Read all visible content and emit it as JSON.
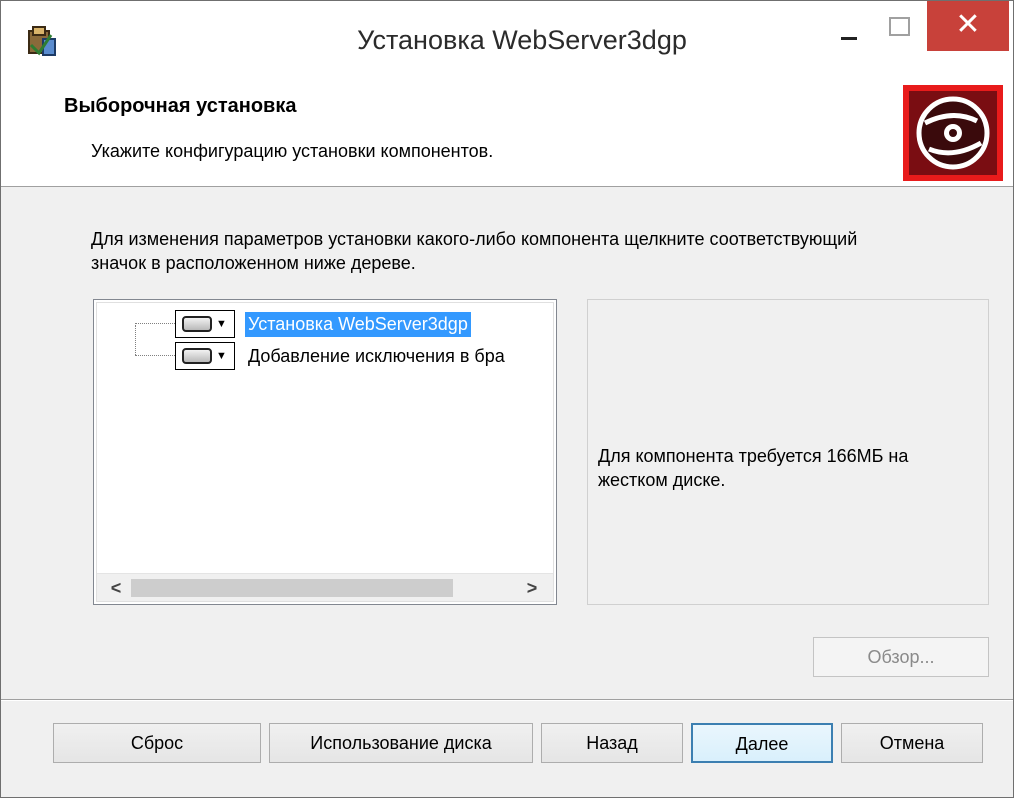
{
  "window": {
    "title": "Установка WebServer3dgp",
    "icons": {
      "app": "installer-icon",
      "minimize": "minimize-icon",
      "maximize": "maximize-icon",
      "close": "close-icon"
    },
    "close_glyph": "✕"
  },
  "header": {
    "title": "Выборочная установка",
    "subtitle": "Укажите конфигурацию установки компонентов.",
    "icon": "disc-icon",
    "accent_color": "#e81b1b"
  },
  "instructions": "Для изменения параметров установки какого-либо компонента щелкните соответствующий значок в расположенном ниже дереве.",
  "feature_tree": {
    "items": [
      {
        "label": "Установка WebServer3dgp",
        "selected": true,
        "icon": "drive-icon"
      },
      {
        "label": "Добавление исключения в бра",
        "selected": false,
        "icon": "drive-icon"
      }
    ],
    "scroll_left": "<",
    "scroll_right": ">"
  },
  "info": {
    "text": "Для компонента требуется 166МБ на жестком диске."
  },
  "buttons": {
    "browse": "Обзор...",
    "reset": "Сброс",
    "disk_usage": "Использование диска",
    "back": "Назад",
    "next": "Далее",
    "cancel": "Отмена"
  }
}
